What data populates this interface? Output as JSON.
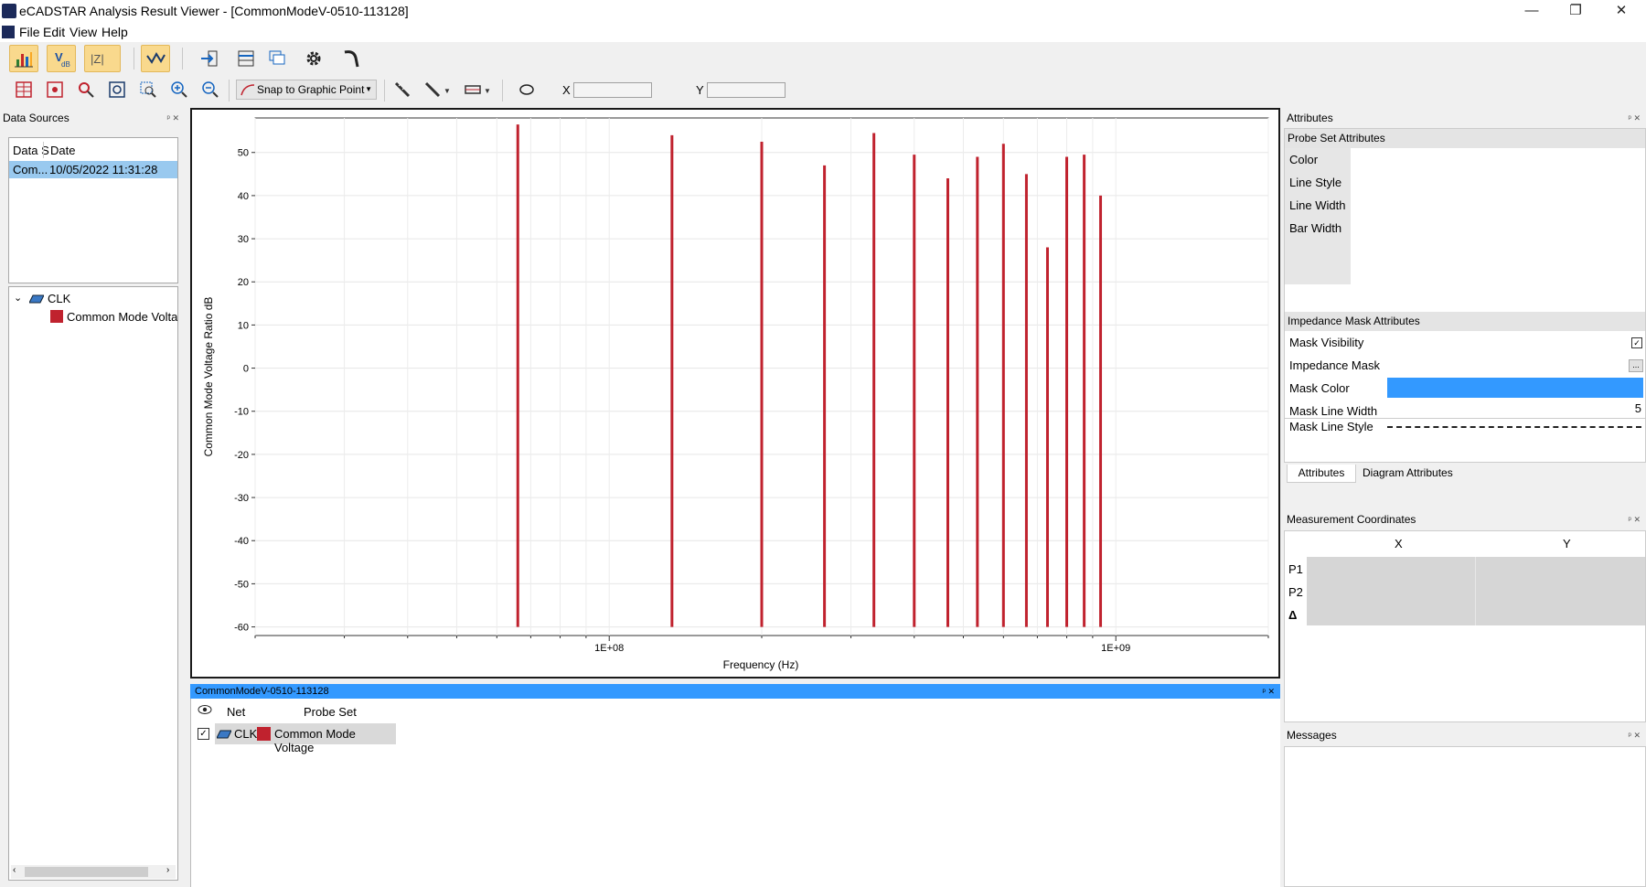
{
  "window": {
    "title": "eCADSTAR Analysis Result Viewer - [CommonModeV-0510-113128]",
    "minimize": "—",
    "restore": "❐",
    "close": "✕"
  },
  "menu": {
    "file": "File",
    "edit": "Edit",
    "view": "View",
    "help": "Help"
  },
  "toolbar": {
    "snap_label": "Snap to Graphic Point",
    "x_label": "X",
    "y_label": "Y",
    "x_value": "",
    "y_value": ""
  },
  "data_sources": {
    "title": "Data Sources",
    "columns": [
      "Data S",
      "Date"
    ],
    "rows": [
      {
        "source": "Com...",
        "date": "10/05/2022 11:31:28"
      }
    ],
    "tree": {
      "net": "CLK",
      "probe": "Common Mode Voltage"
    }
  },
  "chart_data": {
    "type": "bar",
    "xlabel": "Frequency (Hz)",
    "ylabel": "Common Mode Voltage Ratio dB",
    "x_scale": "log",
    "xlim": [
      20000000,
      2000000000
    ],
    "ylim": [
      -62,
      58
    ],
    "x_ticks": [
      "1E+08",
      "1E+09"
    ],
    "y_ticks": [
      50,
      40,
      30,
      20,
      10,
      0,
      -10,
      -20,
      -30,
      -40,
      -50,
      -60
    ],
    "grid": true,
    "color": "#c0222e",
    "baseline": -60,
    "series": [
      {
        "x": [
          66000000,
          133000000,
          200000000,
          266000000,
          333000000,
          400000000,
          466000000,
          533000000,
          600000000,
          666000000,
          733000000,
          800000000,
          866000000,
          933000000
        ],
        "values": [
          56.5,
          54,
          52.5,
          47,
          54.5,
          49.5,
          44,
          49,
          52,
          45,
          28,
          49,
          49.5,
          40
        ]
      }
    ]
  },
  "document": {
    "tab_title": "CommonModeV-0510-113128",
    "col_net": "Net",
    "col_probe": "Probe Set",
    "row_net": "CLK",
    "row_probe": "Common Mode Voltage"
  },
  "attributes": {
    "title": "Attributes",
    "probe_set_header": "Probe Set Attributes",
    "color": "Color",
    "line_style": "Line Style",
    "line_width": "Line Width",
    "bar_width": "Bar Width",
    "mask_header": "Impedance Mask Attributes",
    "mask_visibility": "Mask Visibility",
    "impedance_mask": "Impedance Mask",
    "impedance_mask_btn": "...",
    "mask_color": "Mask Color",
    "mask_color_value": "#3399ff",
    "mask_line_width": "Mask Line Width",
    "mask_line_width_value": "5",
    "mask_line_style": "Mask Line Style",
    "tab_attributes": "Attributes",
    "tab_diagram": "Diagram Attributes"
  },
  "measurement": {
    "title": "Measurement Coordinates",
    "col_x": "X",
    "col_y": "Y",
    "p1": "P1",
    "p2": "P2",
    "delta": "Δ"
  },
  "messages": {
    "title": "Messages"
  }
}
